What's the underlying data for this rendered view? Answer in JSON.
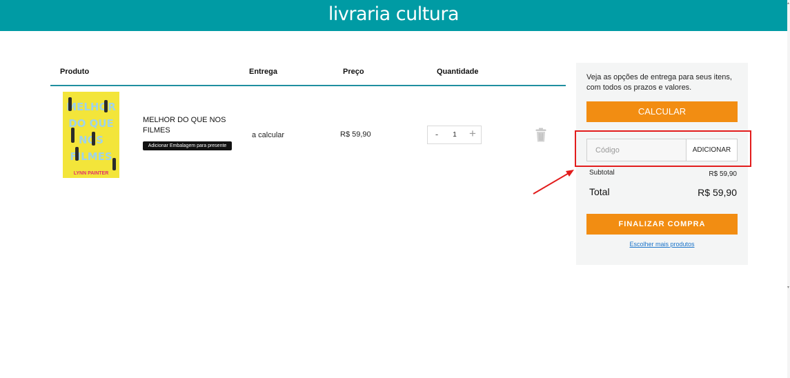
{
  "header": {
    "logo_text": "livraria cultura",
    "brand_color": "#009ba4"
  },
  "cart": {
    "columns": [
      "Produto",
      "Entrega",
      "Preço",
      "Quantidade"
    ],
    "items": [
      {
        "cover": {
          "title_lines": [
            "Melhor",
            "do que",
            "nos",
            "filmes"
          ],
          "author": "LYNN PAINTER",
          "cover_color": "#f3e53a"
        },
        "name": "MELHOR DO QUE NOS FILMES",
        "gift_label": "Adicionar Embalagem para presente",
        "delivery": "a calcular",
        "price": "R$ 59,90",
        "quantity": "1",
        "qty_minus": "-",
        "qty_plus": "+",
        "remove_icon": "trash-icon"
      }
    ]
  },
  "summary": {
    "shipping_text": "Veja as opções de entrega para seus itens, com todos os prazos e valores.",
    "calculate_label": "CALCULAR",
    "coupon_placeholder": "Código",
    "coupon_value": "",
    "add_label": "ADICIONAR",
    "subtotal_label": "Subtotal",
    "subtotal_value": "R$ 59,90",
    "total_label": "Total",
    "total_value": "R$ 59,90",
    "finish_label": "FINALIZAR COMPRA",
    "more_products_label": "Escolher mais produtos",
    "accent_color": "#f28d12"
  },
  "annotation": {
    "highlight_color": "#e21c1c"
  }
}
